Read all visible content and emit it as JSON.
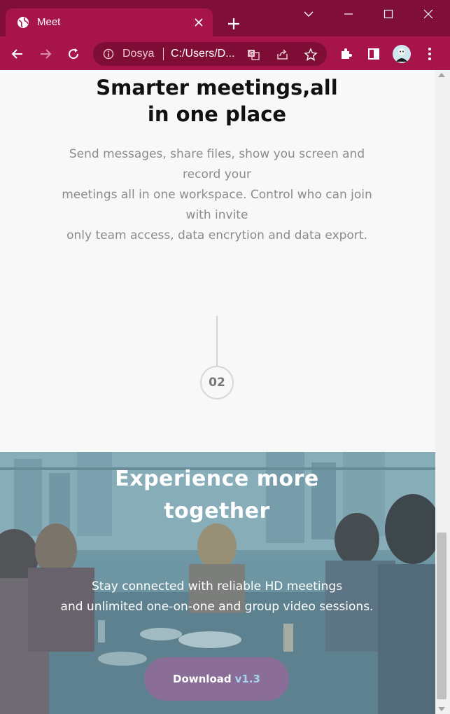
{
  "browser": {
    "tab_title": "Meet",
    "omnibox": {
      "site": "Dosya",
      "url": "C:/Users/D..."
    },
    "colors": {
      "frame": "#a6144a",
      "tab_strip": "#7f0f38"
    },
    "icons": [
      "globe-icon",
      "close-icon",
      "plus-icon",
      "chevron-down-icon",
      "minimize-icon",
      "maximize-icon",
      "window-close-icon",
      "back-icon",
      "forward-icon",
      "reload-icon",
      "info-icon",
      "translate-icon",
      "share-icon",
      "star-icon",
      "extensions-icon",
      "side-panel-icon",
      "avatar",
      "menu-icon"
    ]
  },
  "page": {
    "heading_line1": "Smarter meetings,all",
    "heading_line2": "in one place",
    "sub_line1": "Send messages, share files, show you screen and",
    "sub_line2": "record your",
    "sub_line3": "meetings all in one workspace. Control who can join",
    "sub_line4": "with invite",
    "sub_line5": "only team access, data encrytion and data export.",
    "step_number": "02"
  },
  "hero": {
    "title_line1": "Experience more",
    "title_line2": "together",
    "text_line1": "Stay connected with reliable HD meetings",
    "text_line2": "and unlimited one-on-one and group video sessions.",
    "download_label": "Download",
    "download_version": "v1.3",
    "colors": {
      "button": "#8a6e97",
      "version": "#a6d3ee"
    }
  }
}
